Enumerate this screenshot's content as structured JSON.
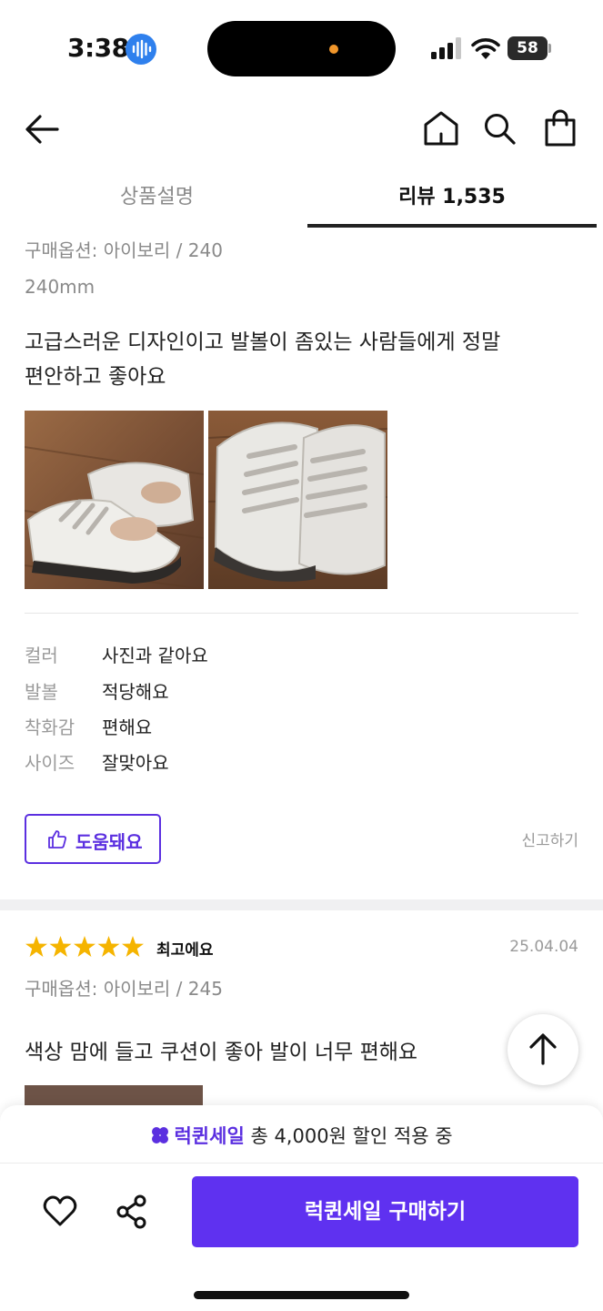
{
  "status_bar": {
    "time": "3:38",
    "battery": "58"
  },
  "tabs": [
    {
      "label": "상품설명"
    },
    {
      "label": "리뷰 1,535"
    }
  ],
  "review1": {
    "option": "구매옵션: 아이보리 / 240",
    "size_text": "240mm",
    "body_line1": "고급스러운 디자인이고 발볼이 좀있는 사람들에게 정말",
    "body_line2": "편안하고 좋아요",
    "evaluations": [
      {
        "label": "컬러",
        "value": "사진과 같아요"
      },
      {
        "label": "발볼",
        "value": "적당해요"
      },
      {
        "label": "착화감",
        "value": "편해요"
      },
      {
        "label": "사이즈",
        "value": "잘맞아요"
      }
    ],
    "helpful_label": "도움돼요",
    "report_label": "신고하기"
  },
  "review2": {
    "rating": 5,
    "title": "최고에요",
    "date": "25.04.04",
    "option": "구매옵션: 아이보리 / 245",
    "body": "색상 맘에 들고 쿠션이 좋아 발이 너무 편해요"
  },
  "sale_banner": {
    "brand": "럭퀸세일",
    "text": "총 4,000원 할인 적용 중"
  },
  "buy_button": {
    "label": "럭퀸세일 구매하기"
  },
  "colors": {
    "accent": "#5f31f0",
    "star": "#f5b400"
  }
}
